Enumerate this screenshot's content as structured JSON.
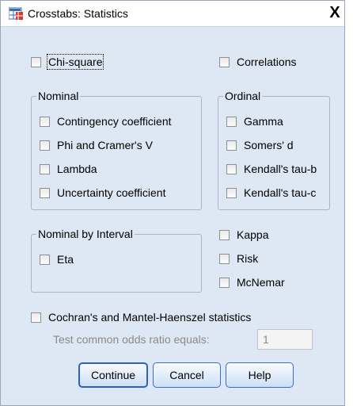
{
  "title": "Crosstabs: Statistics",
  "close_label": "X",
  "chi_square": "Chi-square",
  "correlations": "Correlations",
  "nominal": {
    "legend": "Nominal",
    "items": [
      "Contingency coefficient",
      "Phi and Cramer's V",
      "Lambda",
      "Uncertainty coefficient"
    ]
  },
  "ordinal": {
    "legend": "Ordinal",
    "items": [
      "Gamma",
      "Somers' d",
      "Kendall's tau-b",
      "Kendall's tau-c"
    ]
  },
  "nominal_by_interval": {
    "legend": "Nominal by Interval",
    "items": [
      "Eta"
    ]
  },
  "other": [
    "Kappa",
    "Risk",
    "McNemar"
  ],
  "cochran": "Cochran's and Mantel-Haenszel statistics",
  "odds_label": "Test common odds ratio equals:",
  "odds_value": "1",
  "buttons": {
    "continue": "Continue",
    "cancel": "Cancel",
    "help": "Help"
  },
  "colors": {
    "background": "#dee7f4",
    "button_border": "#3c6fc0"
  }
}
